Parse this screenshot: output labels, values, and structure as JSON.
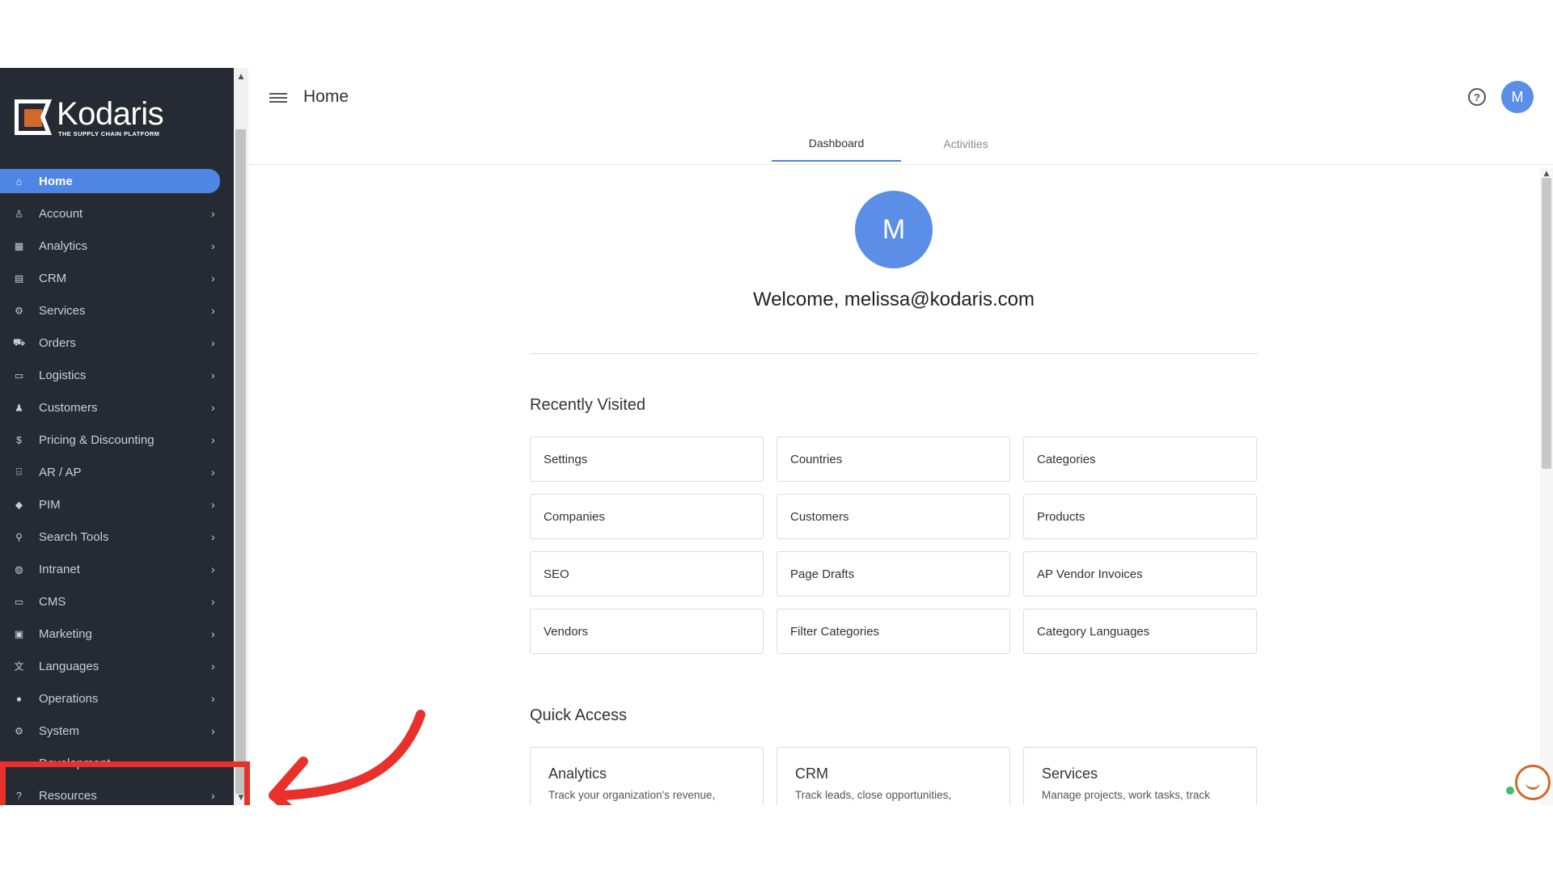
{
  "sidebar": {
    "brand": "Kodaris",
    "tagline": "THE SUPPLY CHAIN PLATFORM",
    "items": [
      {
        "label": "Home",
        "icon": "home-icon",
        "glyph": "⌂",
        "active": true
      },
      {
        "label": "Account",
        "icon": "user-icon",
        "glyph": "♙"
      },
      {
        "label": "Analytics",
        "icon": "analytics-icon",
        "glyph": "▦"
      },
      {
        "label": "CRM",
        "icon": "crm-icon",
        "glyph": "▤"
      },
      {
        "label": "Services",
        "icon": "services-icon",
        "glyph": "⚙"
      },
      {
        "label": "Orders",
        "icon": "truck-icon",
        "glyph": "⛟"
      },
      {
        "label": "Logistics",
        "icon": "logistics-icon",
        "glyph": "▭"
      },
      {
        "label": "Customers",
        "icon": "people-icon",
        "glyph": "♟"
      },
      {
        "label": "Pricing & Discounting",
        "icon": "dollar-icon",
        "glyph": "$"
      },
      {
        "label": "AR / AP",
        "icon": "bank-icon",
        "glyph": "⌸"
      },
      {
        "label": "PIM",
        "icon": "tag-icon",
        "glyph": "◆"
      },
      {
        "label": "Search Tools",
        "icon": "search-icon",
        "glyph": "⚲"
      },
      {
        "label": "Intranet",
        "icon": "globe-icon",
        "glyph": "◍"
      },
      {
        "label": "CMS",
        "icon": "cms-icon",
        "glyph": "▭"
      },
      {
        "label": "Marketing",
        "icon": "marketing-icon",
        "glyph": "▣"
      },
      {
        "label": "Languages",
        "icon": "translate-icon",
        "glyph": "文"
      },
      {
        "label": "Operations",
        "icon": "operations-icon",
        "glyph": "●"
      },
      {
        "label": "System",
        "icon": "gear-icon",
        "glyph": "⚙"
      },
      {
        "label": "Development",
        "icon": "code-icon",
        "glyph": "‹›"
      },
      {
        "label": "Resources",
        "icon": "help-circle-icon",
        "glyph": "?"
      }
    ]
  },
  "header": {
    "title": "Home",
    "avatar_initial": "M",
    "help_glyph": "?",
    "tabs": [
      {
        "label": "Dashboard",
        "active": true
      },
      {
        "label": "Activities",
        "active": false
      }
    ]
  },
  "main": {
    "avatar_initial": "M",
    "welcome": "Welcome, melissa@kodaris.com",
    "recently_visited_title": "Recently Visited",
    "recent": [
      "Settings",
      "Countries",
      "Categories",
      "Companies",
      "Customers",
      "Products",
      "SEO",
      "Page Drafts",
      "AP Vendor Invoices",
      "Vendors",
      "Filter Categories",
      "Category Languages"
    ],
    "quick_access_title": "Quick Access",
    "quick": [
      {
        "title": "Analytics",
        "desc": "Track your organization's revenue,"
      },
      {
        "title": "CRM",
        "desc": "Track leads, close opportunities,"
      },
      {
        "title": "Services",
        "desc": "Manage projects, work tasks, track"
      }
    ]
  },
  "colors": {
    "sidebar_bg": "#262b33",
    "accent": "#4f86e6",
    "avatar": "#5b8ee6",
    "annotation": "#e9302a",
    "brand_orange": "#d2692b"
  }
}
